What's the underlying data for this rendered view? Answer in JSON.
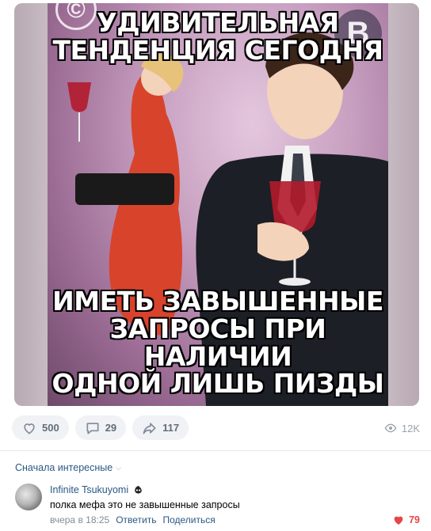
{
  "meme": {
    "caption_top": [
      "УДИВИТЕЛЬНАЯ",
      "ТЕНДЕНЦИЯ СЕГОДНЯ"
    ],
    "caption_bottom": [
      "ИМЕТЬ ЗАВЫШЕННЫЕ",
      "ЗАПРОСЫ ПРИ НАЛИЧИИ",
      "ОДНОЙ ЛИШЬ ПИЗДЫ"
    ]
  },
  "actions": {
    "likes": "500",
    "comments": "29",
    "shares": "117",
    "views": "12K"
  },
  "sort_label": "Сначала интересные",
  "comment": {
    "author": "Infinite Tsukuyomi",
    "text": "полка мефа это не завышенные запросы",
    "time": "вчера в 18:25",
    "reply": "Ответить",
    "share": "Поделиться",
    "likes": "79"
  },
  "colors": {
    "link": "#2a5885",
    "muted": "#818c99",
    "like_active": "#e64646",
    "pill_bg": "#f0f2f5"
  }
}
